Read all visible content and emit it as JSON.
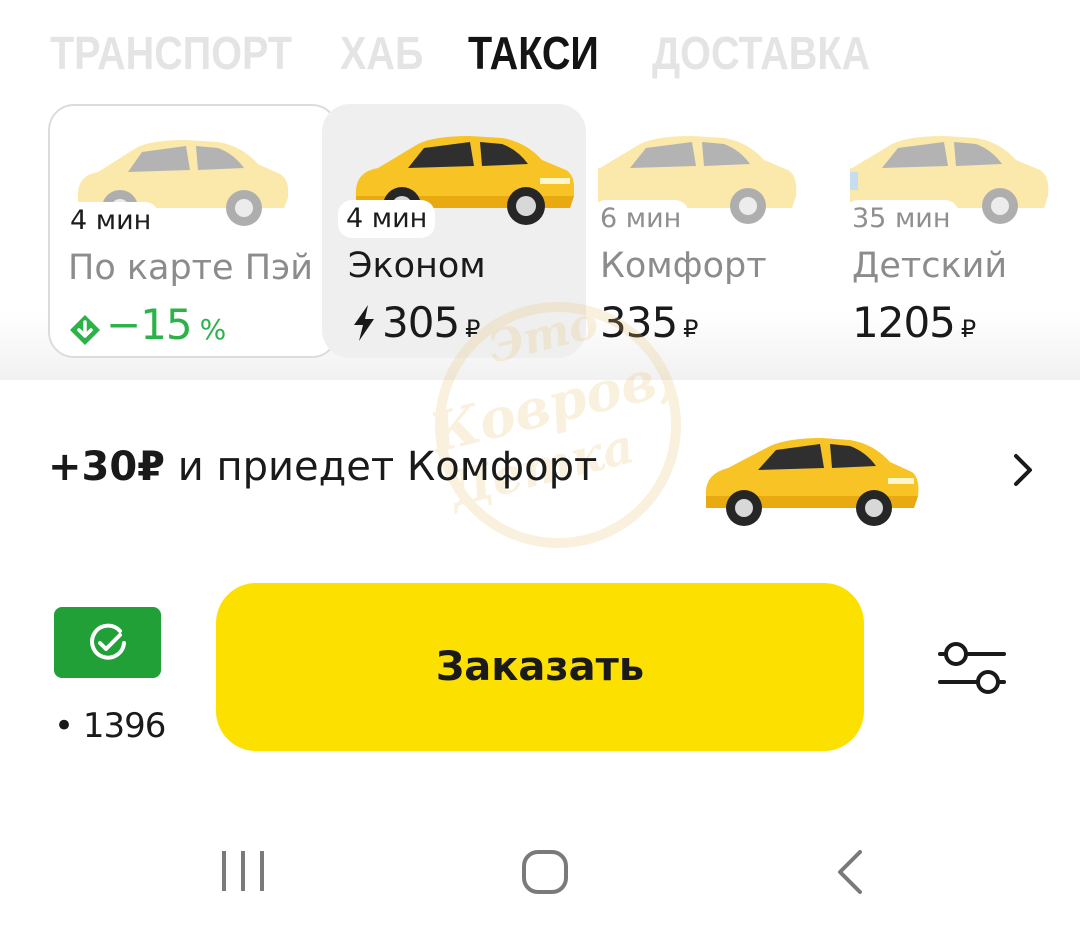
{
  "tabs": [
    {
      "label": "ТРАНСПОРТ",
      "active": false
    },
    {
      "label": "ХАБ",
      "active": false
    },
    {
      "label": "ТАКСИ",
      "active": true
    },
    {
      "label": "ДОСТАВКА",
      "active": false
    }
  ],
  "tariffs": [
    {
      "eta": "4 мин",
      "name": "По карте Пэй",
      "price": "−15",
      "price_unit": "%",
      "icon": "discount-arrow-icon",
      "state": "outlined"
    },
    {
      "eta": "4 мин",
      "name": "Эконом",
      "price": "305",
      "price_unit": "₽",
      "icon": "lightning-icon",
      "state": "selected"
    },
    {
      "eta": "6 мин",
      "name": "Комфорт",
      "price": "335",
      "price_unit": "₽",
      "state": "unselected"
    },
    {
      "eta": "35 мин",
      "name": "Детский",
      "price": "1205",
      "price_unit": "₽",
      "state": "unselected"
    }
  ],
  "upsell": {
    "amount": "+30₽",
    "text": " и приедет Комфорт",
    "icon": "chevron-right-icon"
  },
  "payment": {
    "icon": "sberpay-check-icon",
    "balance": "• 1396"
  },
  "order_button": {
    "label": "Заказать"
  },
  "settings": {
    "icon": "sliders-icon"
  },
  "watermark": {
    "line1": "Это",
    "line2": "Ковров,",
    "line3": "Детка"
  },
  "nav_bar": {
    "recent": "recent-apps-icon",
    "home": "home-icon",
    "back": "back-icon"
  },
  "colors": {
    "brand_yellow": "#fce000",
    "discount_green": "#2db24a",
    "sber_green": "#21a038",
    "selected_card": "#efefef"
  }
}
